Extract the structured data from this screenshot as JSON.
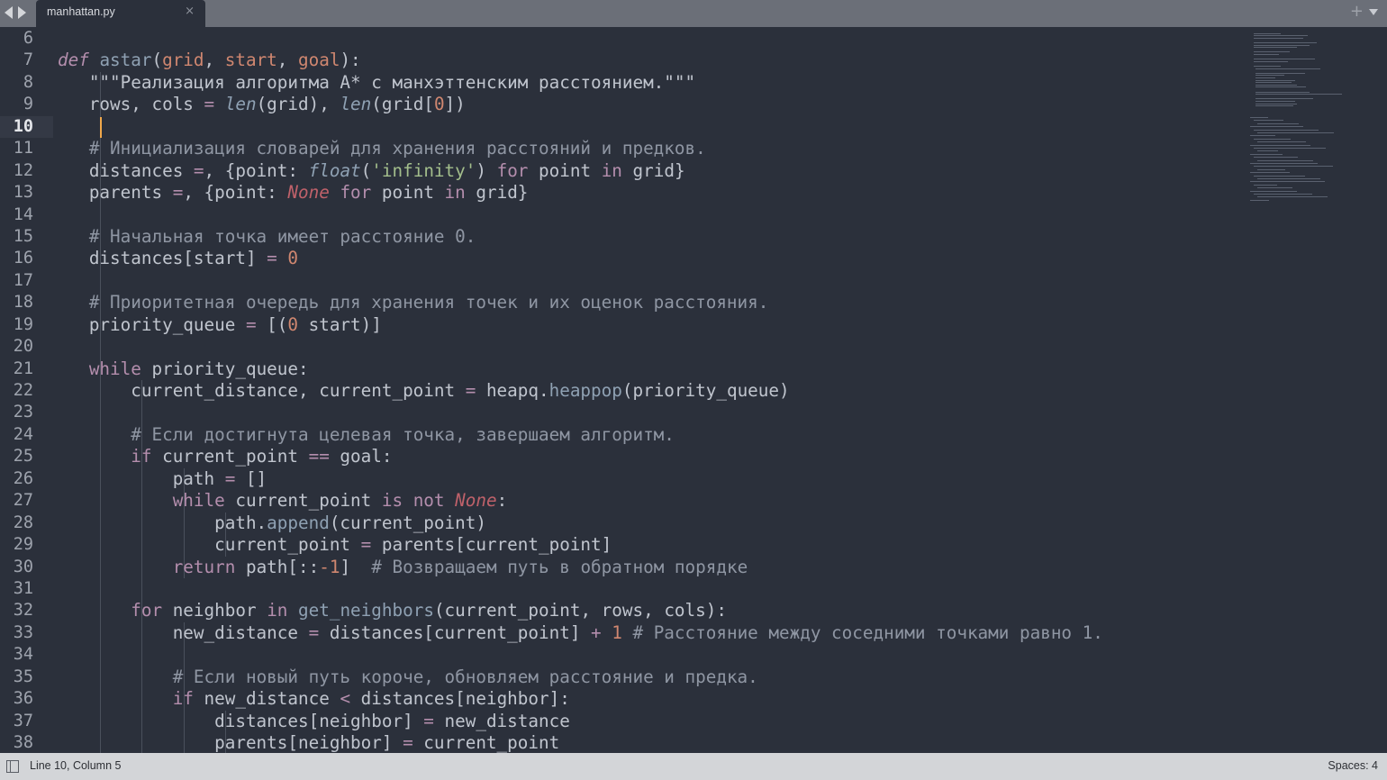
{
  "tabbar": {
    "tab_title": "manhattan.py",
    "close_glyph": "×",
    "new_tab_glyph": "+"
  },
  "editor": {
    "current_line": 10,
    "lines": [
      {
        "n": "6"
      },
      {
        "n": "7"
      },
      {
        "n": "8"
      },
      {
        "n": "9"
      },
      {
        "n": "10"
      },
      {
        "n": "11"
      },
      {
        "n": "12"
      },
      {
        "n": "13"
      },
      {
        "n": "14"
      },
      {
        "n": "15"
      },
      {
        "n": "16"
      },
      {
        "n": "17"
      },
      {
        "n": "18"
      },
      {
        "n": "19"
      },
      {
        "n": "20"
      },
      {
        "n": "21"
      },
      {
        "n": "22"
      },
      {
        "n": "23"
      },
      {
        "n": "24"
      },
      {
        "n": "25"
      },
      {
        "n": "26"
      },
      {
        "n": "27"
      },
      {
        "n": "28"
      },
      {
        "n": "29"
      },
      {
        "n": "30"
      },
      {
        "n": "31"
      },
      {
        "n": "32"
      },
      {
        "n": "33"
      },
      {
        "n": "34"
      },
      {
        "n": "35"
      },
      {
        "n": "36"
      },
      {
        "n": "37"
      },
      {
        "n": "38"
      }
    ],
    "code": [
      [],
      [
        [
          "kwi",
          "def"
        ],
        [
          "",
          "  "
        ],
        [
          "fn",
          "astar"
        ],
        [
          "",
          "("
        ],
        [
          "prm",
          "grid"
        ],
        [
          "",
          ", "
        ],
        [
          "prm",
          "start"
        ],
        [
          "",
          ", "
        ],
        [
          "prm",
          "goal"
        ],
        [
          "",
          "):"
        ]
      ],
      [
        [
          "",
          "    "
        ],
        [
          "doc",
          "\"\"\"Реализация алгоритма A* с манхэттенским расстоянием.\"\"\""
        ]
      ],
      [
        [
          "",
          "    rows, cols "
        ],
        [
          "opk",
          "="
        ],
        [
          "",
          "  "
        ],
        [
          "fni",
          "len"
        ],
        [
          "",
          "(grid), "
        ],
        [
          "fni",
          "len"
        ],
        [
          "",
          "(grid["
        ],
        [
          "num",
          "0"
        ],
        [
          "",
          "])"
        ]
      ],
      [
        [
          "",
          "    "
        ]
      ],
      [
        [
          "",
          "    "
        ],
        [
          "cmt",
          "# Инициализация словарей для хранения расстояний и предков."
        ]
      ],
      [
        [
          "",
          "    distances "
        ],
        [
          "opk",
          "="
        ],
        [
          "",
          ", {point: "
        ],
        [
          "fni",
          "float"
        ],
        [
          "",
          "("
        ],
        [
          "str",
          "'infinity'"
        ],
        [
          "",
          ") "
        ],
        [
          "kw",
          "for"
        ],
        [
          "",
          ", point "
        ],
        [
          "kw",
          "in"
        ],
        [
          "",
          ", grid}"
        ]
      ],
      [
        [
          "",
          "    parents "
        ],
        [
          "opk",
          "="
        ],
        [
          "",
          ", {point: "
        ],
        [
          "nonec",
          "None"
        ],
        [
          "",
          "  "
        ],
        [
          "kw",
          "for"
        ],
        [
          "",
          "  point "
        ],
        [
          "kw",
          "in"
        ],
        [
          "",
          "  grid}"
        ]
      ],
      [],
      [
        [
          "",
          "    "
        ],
        [
          "cmt",
          "# Начальная точка имеет расстояние 0."
        ]
      ],
      [
        [
          "",
          "    distances[start] "
        ],
        [
          "opk",
          "="
        ],
        [
          "",
          "  "
        ],
        [
          "num",
          "0"
        ]
      ],
      [],
      [
        [
          "",
          "    "
        ],
        [
          "cmt",
          "# Приоритетная очередь для хранения точек и их оценок расстояния."
        ]
      ],
      [
        [
          "",
          "    priority_queue "
        ],
        [
          "opk",
          "="
        ],
        [
          "",
          "  [("
        ],
        [
          "num",
          "0"
        ],
        [
          "",
          ", start)]"
        ]
      ],
      [],
      [
        [
          "",
          "    "
        ],
        [
          "kw",
          "while"
        ],
        [
          "",
          "  priority_queue:"
        ]
      ],
      [
        [
          "",
          "        current_distance, current_point "
        ],
        [
          "opk",
          "="
        ],
        [
          "",
          "  heapq."
        ],
        [
          "fn",
          "heappop"
        ],
        [
          "",
          "(priority_queue)"
        ]
      ],
      [],
      [
        [
          "",
          "        "
        ],
        [
          "cmt",
          "# Если достигнута целевая точка, завершаем алгоритм."
        ]
      ],
      [
        [
          "",
          "        "
        ],
        [
          "kw",
          "if"
        ],
        [
          "",
          "  current_point "
        ],
        [
          "opk",
          "=="
        ],
        [
          "",
          "  goal:"
        ]
      ],
      [
        [
          "",
          "            path "
        ],
        [
          "opk",
          "="
        ],
        [
          "",
          "  []"
        ]
      ],
      [
        [
          "",
          "            "
        ],
        [
          "kw",
          "while"
        ],
        [
          "",
          "  current_point "
        ],
        [
          "kw",
          "is"
        ],
        [
          "",
          "  "
        ],
        [
          "kw",
          "not"
        ],
        [
          "",
          "  "
        ],
        [
          "nonec",
          "None"
        ],
        [
          "",
          ":"
        ]
      ],
      [
        [
          "",
          "                path."
        ],
        [
          "fn",
          "append"
        ],
        [
          "",
          "(current_point)"
        ]
      ],
      [
        [
          "",
          "                current_point "
        ],
        [
          "opk",
          "="
        ],
        [
          "",
          "  parents[current_point]"
        ]
      ],
      [
        [
          "",
          "            "
        ],
        [
          "kw",
          "return"
        ],
        [
          "",
          "  path[::"
        ],
        [
          "num",
          "-1"
        ],
        [
          "",
          "]  "
        ],
        [
          "cmt",
          "# Возвращаем путь в обратном порядке"
        ]
      ],
      [],
      [
        [
          "",
          "        "
        ],
        [
          "kw",
          "for"
        ],
        [
          "",
          "  neighbor "
        ],
        [
          "kw",
          "in"
        ],
        [
          "",
          "  "
        ],
        [
          "fn",
          "get_neighbors"
        ],
        [
          "",
          "(current_point, rows, cols):"
        ]
      ],
      [
        [
          "",
          "            new_distance "
        ],
        [
          "opk",
          "="
        ],
        [
          "",
          "  distances[current_point] "
        ],
        [
          "opk",
          "+"
        ],
        [
          "",
          "  "
        ],
        [
          "num",
          "1"
        ],
        [
          "",
          "  "
        ],
        [
          "cmt",
          "# Расстояние между соседними точками равно 1."
        ]
      ],
      [],
      [
        [
          "",
          "            "
        ],
        [
          "cmt",
          "# Если новый путь короче, обновляем расстояние и предка."
        ]
      ],
      [
        [
          "",
          "            "
        ],
        [
          "kw",
          "if"
        ],
        [
          "",
          "  new_distance "
        ],
        [
          "opk",
          "<"
        ],
        [
          "",
          "  distances[neighbor]:"
        ]
      ],
      [
        [
          "",
          "                distances[neighbor] "
        ],
        [
          "opk",
          "="
        ],
        [
          "",
          "  new_distance"
        ]
      ],
      [
        [
          "",
          "                parents[neighbor] "
        ],
        [
          "opk",
          "="
        ],
        [
          "",
          "  current_point"
        ]
      ]
    ]
  },
  "statusbar": {
    "position": "Line 10, Column 5",
    "spaces": "Spaces: 4"
  },
  "colors": {
    "background": "#2b303b",
    "keyword": "#b48ead",
    "function": "#8fa1b3",
    "param": "#d08770",
    "string": "#a3be8c",
    "comment": "#8f96a3",
    "none": "#bf616a",
    "caret": "#f0a84b"
  },
  "icons": [
    "back-arrow-icon",
    "forward-arrow-icon",
    "close-icon",
    "plus-icon",
    "chevron-down-icon",
    "panel-toggle-icon"
  ]
}
